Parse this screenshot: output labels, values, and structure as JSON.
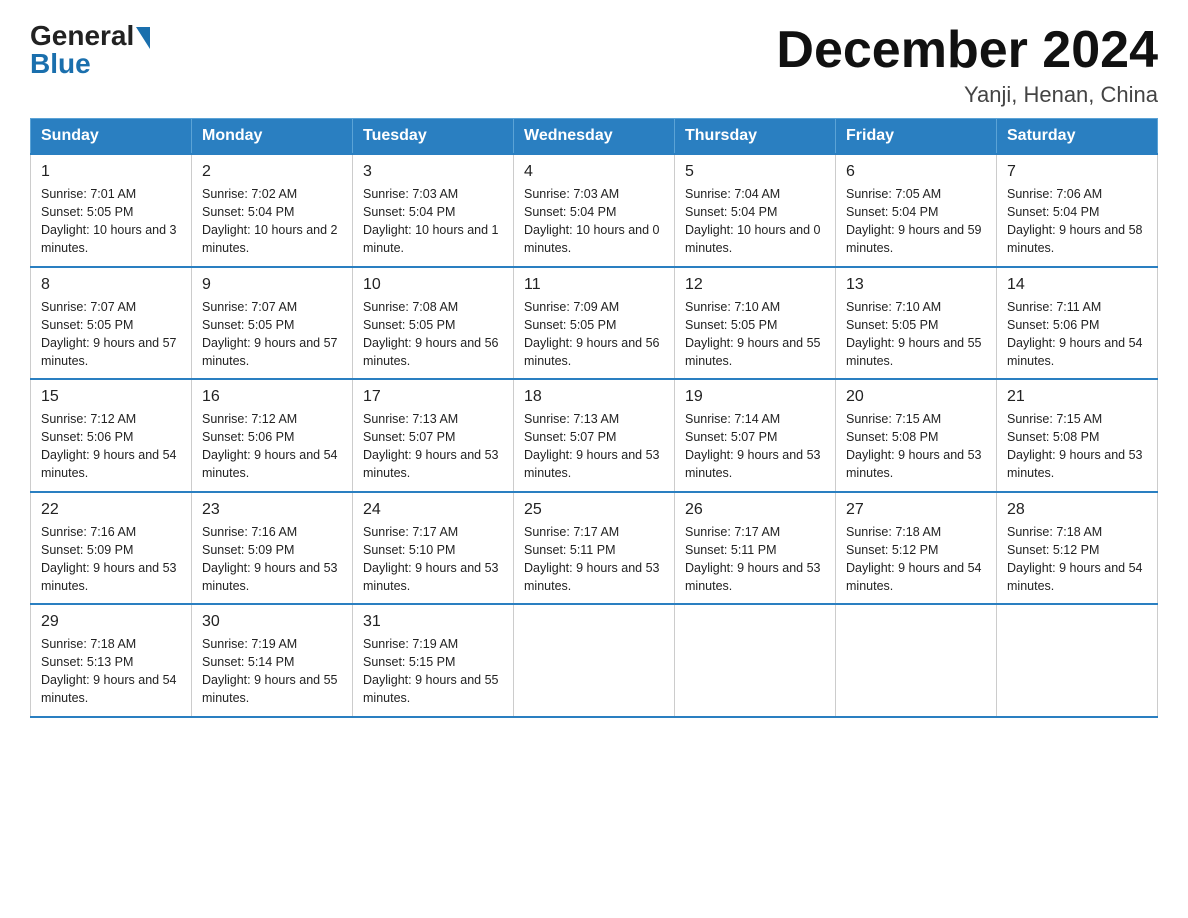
{
  "logo": {
    "general": "General",
    "blue": "Blue"
  },
  "title": {
    "month_year": "December 2024",
    "location": "Yanji, Henan, China"
  },
  "weekdays": [
    "Sunday",
    "Monday",
    "Tuesday",
    "Wednesday",
    "Thursday",
    "Friday",
    "Saturday"
  ],
  "weeks": [
    [
      {
        "day": "1",
        "sunrise": "7:01 AM",
        "sunset": "5:05 PM",
        "daylight": "10 hours and 3 minutes."
      },
      {
        "day": "2",
        "sunrise": "7:02 AM",
        "sunset": "5:04 PM",
        "daylight": "10 hours and 2 minutes."
      },
      {
        "day": "3",
        "sunrise": "7:03 AM",
        "sunset": "5:04 PM",
        "daylight": "10 hours and 1 minute."
      },
      {
        "day": "4",
        "sunrise": "7:03 AM",
        "sunset": "5:04 PM",
        "daylight": "10 hours and 0 minutes."
      },
      {
        "day": "5",
        "sunrise": "7:04 AM",
        "sunset": "5:04 PM",
        "daylight": "10 hours and 0 minutes."
      },
      {
        "day": "6",
        "sunrise": "7:05 AM",
        "sunset": "5:04 PM",
        "daylight": "9 hours and 59 minutes."
      },
      {
        "day": "7",
        "sunrise": "7:06 AM",
        "sunset": "5:04 PM",
        "daylight": "9 hours and 58 minutes."
      }
    ],
    [
      {
        "day": "8",
        "sunrise": "7:07 AM",
        "sunset": "5:05 PM",
        "daylight": "9 hours and 57 minutes."
      },
      {
        "day": "9",
        "sunrise": "7:07 AM",
        "sunset": "5:05 PM",
        "daylight": "9 hours and 57 minutes."
      },
      {
        "day": "10",
        "sunrise": "7:08 AM",
        "sunset": "5:05 PM",
        "daylight": "9 hours and 56 minutes."
      },
      {
        "day": "11",
        "sunrise": "7:09 AM",
        "sunset": "5:05 PM",
        "daylight": "9 hours and 56 minutes."
      },
      {
        "day": "12",
        "sunrise": "7:10 AM",
        "sunset": "5:05 PM",
        "daylight": "9 hours and 55 minutes."
      },
      {
        "day": "13",
        "sunrise": "7:10 AM",
        "sunset": "5:05 PM",
        "daylight": "9 hours and 55 minutes."
      },
      {
        "day": "14",
        "sunrise": "7:11 AM",
        "sunset": "5:06 PM",
        "daylight": "9 hours and 54 minutes."
      }
    ],
    [
      {
        "day": "15",
        "sunrise": "7:12 AM",
        "sunset": "5:06 PM",
        "daylight": "9 hours and 54 minutes."
      },
      {
        "day": "16",
        "sunrise": "7:12 AM",
        "sunset": "5:06 PM",
        "daylight": "9 hours and 54 minutes."
      },
      {
        "day": "17",
        "sunrise": "7:13 AM",
        "sunset": "5:07 PM",
        "daylight": "9 hours and 53 minutes."
      },
      {
        "day": "18",
        "sunrise": "7:13 AM",
        "sunset": "5:07 PM",
        "daylight": "9 hours and 53 minutes."
      },
      {
        "day": "19",
        "sunrise": "7:14 AM",
        "sunset": "5:07 PM",
        "daylight": "9 hours and 53 minutes."
      },
      {
        "day": "20",
        "sunrise": "7:15 AM",
        "sunset": "5:08 PM",
        "daylight": "9 hours and 53 minutes."
      },
      {
        "day": "21",
        "sunrise": "7:15 AM",
        "sunset": "5:08 PM",
        "daylight": "9 hours and 53 minutes."
      }
    ],
    [
      {
        "day": "22",
        "sunrise": "7:16 AM",
        "sunset": "5:09 PM",
        "daylight": "9 hours and 53 minutes."
      },
      {
        "day": "23",
        "sunrise": "7:16 AM",
        "sunset": "5:09 PM",
        "daylight": "9 hours and 53 minutes."
      },
      {
        "day": "24",
        "sunrise": "7:17 AM",
        "sunset": "5:10 PM",
        "daylight": "9 hours and 53 minutes."
      },
      {
        "day": "25",
        "sunrise": "7:17 AM",
        "sunset": "5:11 PM",
        "daylight": "9 hours and 53 minutes."
      },
      {
        "day": "26",
        "sunrise": "7:17 AM",
        "sunset": "5:11 PM",
        "daylight": "9 hours and 53 minutes."
      },
      {
        "day": "27",
        "sunrise": "7:18 AM",
        "sunset": "5:12 PM",
        "daylight": "9 hours and 54 minutes."
      },
      {
        "day": "28",
        "sunrise": "7:18 AM",
        "sunset": "5:12 PM",
        "daylight": "9 hours and 54 minutes."
      }
    ],
    [
      {
        "day": "29",
        "sunrise": "7:18 AM",
        "sunset": "5:13 PM",
        "daylight": "9 hours and 54 minutes."
      },
      {
        "day": "30",
        "sunrise": "7:19 AM",
        "sunset": "5:14 PM",
        "daylight": "9 hours and 55 minutes."
      },
      {
        "day": "31",
        "sunrise": "7:19 AM",
        "sunset": "5:15 PM",
        "daylight": "9 hours and 55 minutes."
      },
      null,
      null,
      null,
      null
    ]
  ],
  "labels": {
    "sunrise": "Sunrise: ",
    "sunset": "Sunset: ",
    "daylight": "Daylight: "
  }
}
